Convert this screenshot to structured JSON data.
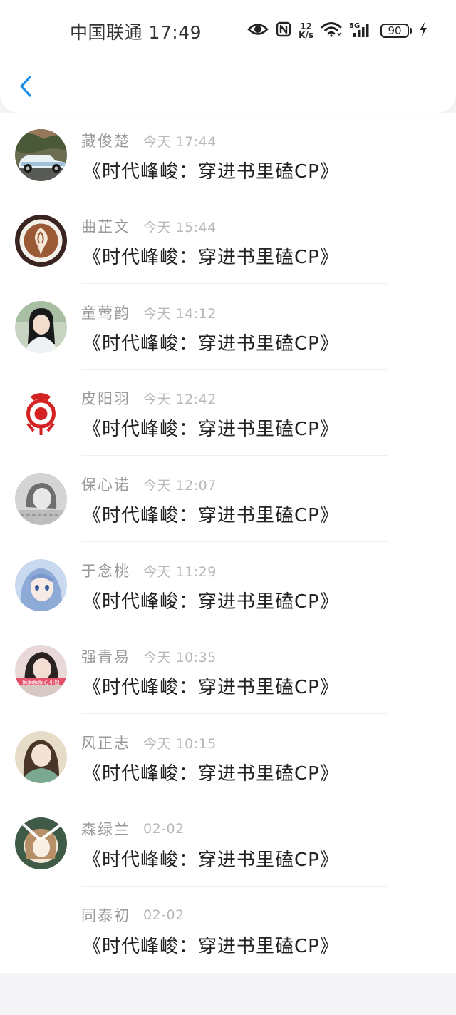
{
  "status_bar": {
    "carrier_time": "中国联通 17:49",
    "net_speed_value": "12",
    "net_speed_unit": "K/s",
    "network_type": "5G",
    "battery": "90"
  },
  "header": {
    "back_icon": "chevron-left-icon",
    "accent_color": "#1a8ee8"
  },
  "messages": [
    {
      "name": "藏俊楚",
      "time": "今天 17:44",
      "text": "《时代峰峻：穿进书里磕CP》",
      "avatar": "vintage-car"
    },
    {
      "name": "曲芷文",
      "time": "今天 15:44",
      "text": "《时代峰峻：穿进书里磕CP》",
      "avatar": "latte-art"
    },
    {
      "name": "童莺韵",
      "time": "今天 14:12",
      "text": "《时代峰峻：穿进书里磕CP》",
      "avatar": "girl-photo"
    },
    {
      "name": "皮阳羽",
      "time": "今天 12:42",
      "text": "《时代峰峻：穿进书里磕CP》",
      "avatar": "red-paper-cut"
    },
    {
      "name": "保心诺",
      "time": "今天 12:07",
      "text": "《时代峰峻：穿进书里磕CP》",
      "avatar": "gray-photo"
    },
    {
      "name": "于念桃",
      "time": "今天 11:29",
      "text": "《时代峰峻：穿进书里磕CP》",
      "avatar": "anime-girl"
    },
    {
      "name": "强青易",
      "time": "今天 10:35",
      "text": "《时代峰峻：穿进书里磕CP》",
      "avatar": "girl-banner",
      "avatar_text": "痴痴痴痴心小姐"
    },
    {
      "name": "风正志",
      "time": "今天 10:15",
      "text": "《时代峰峻：穿进书里磕CP》",
      "avatar": "girl-portrait"
    },
    {
      "name": "森绿兰",
      "time": "02-02",
      "text": "《时代峰峻：穿进书里磕CP》",
      "avatar": "drawn-girl"
    },
    {
      "name": "同泰初",
      "time": "02-02",
      "text": "《时代峰峻：穿进书里磕CP》",
      "avatar": "none"
    }
  ]
}
